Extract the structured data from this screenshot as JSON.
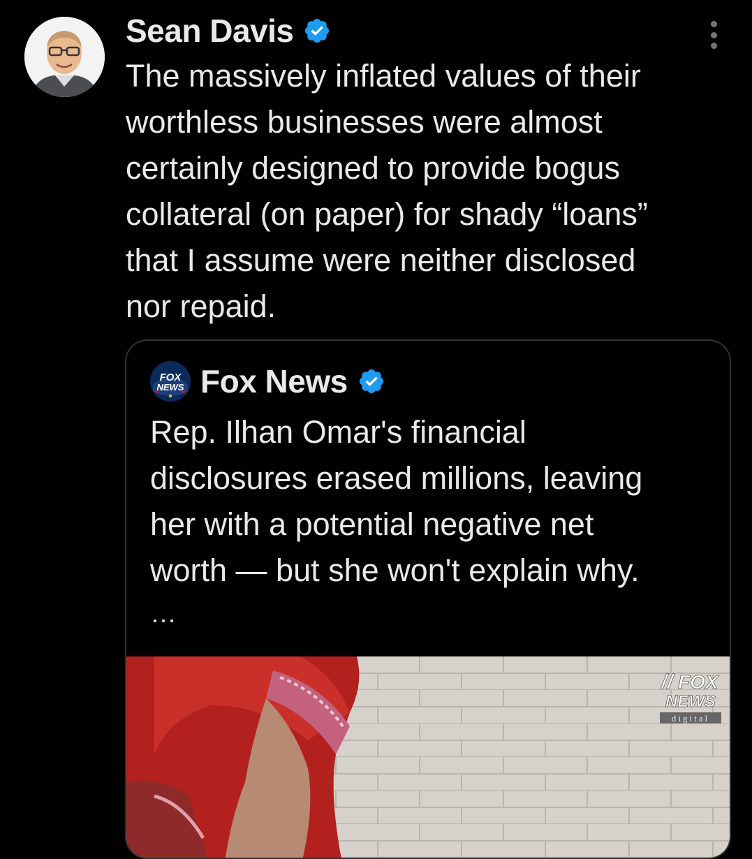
{
  "tweet": {
    "author_name": "Sean Davis",
    "author_avatar": "avatar",
    "verified_icon": "verified-badge-icon",
    "more_icon": "more-options-icon",
    "text": "The massively inflated values of their\nworthless businesses were almost\ncertainly designed to provide bogus\ncollateral (on paper) for shady “loans”\nthat I assume were neither disclosed\nnor repaid."
  },
  "quote": {
    "author_name": "Fox News",
    "logo_text": "FOX NEWS",
    "text": "Rep. Ilhan Omar's financial\ndisclosures erased millions, leaving\nher with a potential negative net\nworth — but she won't explain why.",
    "truncation": "...",
    "media": {
      "watermark_line1": "FOX",
      "watermark_line2": "NEWS",
      "watermark_line3": "digital"
    }
  },
  "colors": {
    "background": "#000000",
    "text": "#e7e9ea",
    "verified": "#1d9bf0",
    "border": "#2f3336"
  }
}
